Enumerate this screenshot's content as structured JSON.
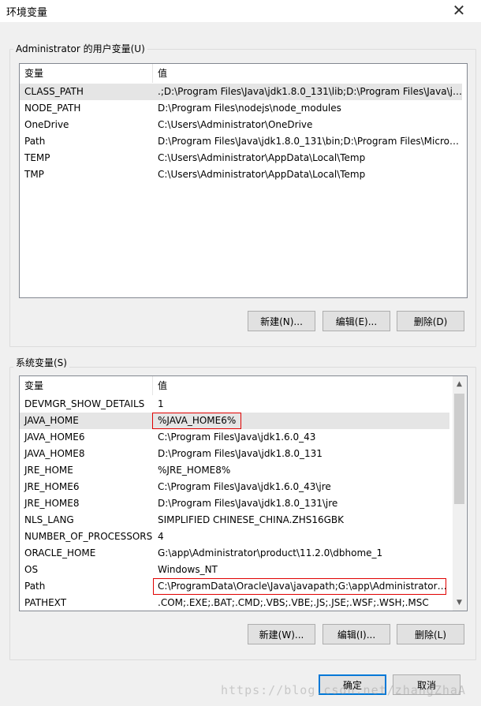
{
  "window": {
    "title": "环境变量"
  },
  "user_group": {
    "label": "Administrator 的用户变量(U)",
    "columns": [
      "变量",
      "值"
    ],
    "rows": [
      {
        "name": "CLASS_PATH",
        "value": ".;D:\\Program Files\\Java\\jdk1.8.0_131\\lib;D:\\Program Files\\Java\\jd..."
      },
      {
        "name": "NODE_PATH",
        "value": "D:\\Program Files\\nodejs\\node_modules"
      },
      {
        "name": "OneDrive",
        "value": "C:\\Users\\Administrator\\OneDrive"
      },
      {
        "name": "Path",
        "value": "D:\\Program Files\\Java\\jdk1.8.0_131\\bin;D:\\Program Files\\Micros..."
      },
      {
        "name": "TEMP",
        "value": "C:\\Users\\Administrator\\AppData\\Local\\Temp"
      },
      {
        "name": "TMP",
        "value": "C:\\Users\\Administrator\\AppData\\Local\\Temp"
      }
    ],
    "buttons": {
      "new": "新建(N)...",
      "edit": "编辑(E)...",
      "delete": "删除(D)"
    }
  },
  "system_group": {
    "label": "系统变量(S)",
    "columns": [
      "变量",
      "值"
    ],
    "rows": [
      {
        "name": "DEVMGR_SHOW_DETAILS",
        "value": "1"
      },
      {
        "name": "JAVA_HOME",
        "value": "%JAVA_HOME6%"
      },
      {
        "name": "JAVA_HOME6",
        "value": "C:\\Program Files\\Java\\jdk1.6.0_43"
      },
      {
        "name": "JAVA_HOME8",
        "value": "D:\\Program Files\\Java\\jdk1.8.0_131"
      },
      {
        "name": "JRE_HOME",
        "value": "%JRE_HOME8%"
      },
      {
        "name": "JRE_HOME6",
        "value": "C:\\Program Files\\Java\\jdk1.6.0_43\\jre"
      },
      {
        "name": "JRE_HOME8",
        "value": "D:\\Program Files\\Java\\jdk1.8.0_131\\jre"
      },
      {
        "name": "NLS_LANG",
        "value": "SIMPLIFIED CHINESE_CHINA.ZHS16GBK"
      },
      {
        "name": "NUMBER_OF_PROCESSORS",
        "value": "4"
      },
      {
        "name": "ORACLE_HOME",
        "value": "G:\\app\\Administrator\\product\\11.2.0\\dbhome_1"
      },
      {
        "name": "OS",
        "value": "Windows_NT"
      },
      {
        "name": "Path",
        "value": "C:\\ProgramData\\Oracle\\Java\\javapath;G:\\app\\Administrator\\..."
      },
      {
        "name": "PATHEXT",
        "value": ".COM;.EXE;.BAT;.CMD;.VBS;.VBE;.JS;.JSE;.WSF;.WSH;.MSC"
      }
    ],
    "buttons": {
      "new": "新建(W)...",
      "edit": "编辑(I)...",
      "delete": "删除(L)"
    }
  },
  "footer": {
    "ok": "确定",
    "cancel": "取消"
  },
  "watermark": "https://blog.csdn.net/zhangZhaA",
  "colors": {
    "highlight": "#e00000",
    "selected_row": "#e5e5e5",
    "primary_border": "#0078d7"
  }
}
